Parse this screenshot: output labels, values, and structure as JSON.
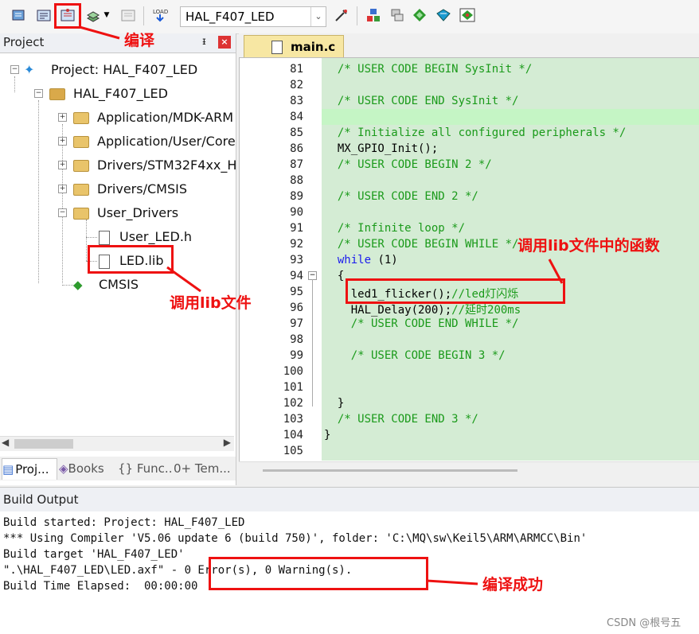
{
  "toolbar": {
    "target": "HAL_F407_LED"
  },
  "project_panel": {
    "title": "Project",
    "pin": "ᵻ",
    "close": "×",
    "tree": [
      {
        "label": "Project: HAL_F407_LED"
      },
      {
        "label": "HAL_F407_LED"
      },
      {
        "label": "Application/MDK-ARM"
      },
      {
        "label": "Application/User/Core"
      },
      {
        "label": "Drivers/STM32F4xx_H"
      },
      {
        "label": "Drivers/CMSIS"
      },
      {
        "label": "User_Drivers"
      },
      {
        "label": "User_LED.h"
      },
      {
        "label": "LED.lib"
      },
      {
        "label": "CMSIS"
      }
    ],
    "tabs": [
      "Proj...",
      "Books",
      "{} Func...",
      "0+ Tem..."
    ]
  },
  "editor": {
    "tab": "main.c",
    "lines": [
      {
        "n": "81",
        "code": "  /* USER CODE BEGIN SysInit */"
      },
      {
        "n": "82",
        "code": ""
      },
      {
        "n": "83",
        "code": "  /* USER CODE END SysInit */"
      },
      {
        "n": "84",
        "code": ""
      },
      {
        "n": "85",
        "code": "  /* Initialize all configured peripherals */"
      },
      {
        "n": "86",
        "code": "  MX_GPIO_Init();"
      },
      {
        "n": "87",
        "code": "  /* USER CODE BEGIN 2 */"
      },
      {
        "n": "88",
        "code": ""
      },
      {
        "n": "89",
        "code": "  /* USER CODE END 2 */"
      },
      {
        "n": "90",
        "code": ""
      },
      {
        "n": "91",
        "code": "  /* Infinite loop */"
      },
      {
        "n": "92",
        "code": "  /* USER CODE BEGIN WHILE */"
      },
      {
        "n": "93",
        "code": "  while (1)"
      },
      {
        "n": "94",
        "code": "  {"
      },
      {
        "n": "95",
        "code": "    led1_flicker();//led灯闪烁"
      },
      {
        "n": "96",
        "code": "    HAL_Delay(200);//延时200ms"
      },
      {
        "n": "97",
        "code": "    /* USER CODE END WHILE */"
      },
      {
        "n": "98",
        "code": ""
      },
      {
        "n": "99",
        "code": "    /* USER CODE BEGIN 3 */"
      },
      {
        "n": "100",
        "code": ""
      },
      {
        "n": "101",
        "code": ""
      },
      {
        "n": "102",
        "code": "  }"
      },
      {
        "n": "103",
        "code": "  /* USER CODE END 3 */"
      },
      {
        "n": "104",
        "code": "}"
      },
      {
        "n": "105",
        "code": ""
      }
    ]
  },
  "build_output": {
    "title": "Build Output",
    "lines": [
      "Build started: Project: HAL_F407_LED",
      "*** Using Compiler 'V5.06 update 6 (build 750)', folder: 'C:\\MQ\\sw\\Keil5\\ARM\\ARMCC\\Bin'",
      "Build target 'HAL_F407_LED'",
      "\".\\HAL_F407_LED\\LED.axf\" - 0 Error(s), 0 Warning(s).",
      "Build Time Elapsed:  00:00:00"
    ]
  },
  "annotations": {
    "compile": "编译",
    "call_lib": "调用lib文件",
    "call_func": "调用lib文件中的函数",
    "success": "编译成功"
  },
  "watermark": "CSDN @根号五",
  "colors": {
    "annotation_red": "#e11111",
    "code_background": "#d4ecd4",
    "comment_green": "#1a9a1a",
    "keyword_blue": "#1a1aee"
  }
}
